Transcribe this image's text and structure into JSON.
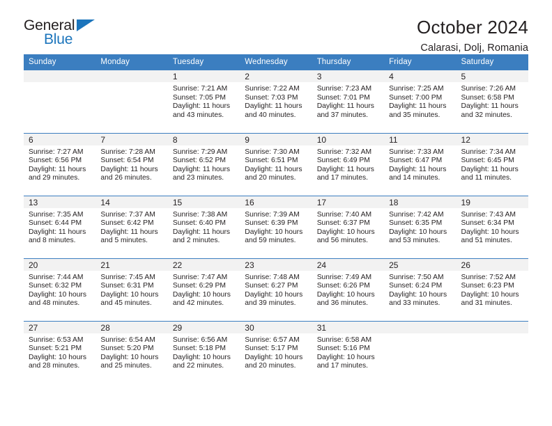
{
  "brand": {
    "name_top": "General",
    "name_bottom": "Blue",
    "accent_color": "#1c75bc"
  },
  "header": {
    "title": "October 2024",
    "subtitle": "Calarasi, Dolj, Romania",
    "header_bg_color": "#3b7ec0",
    "daynum_bg_color": "#f2f2f2"
  },
  "weekdays": [
    "Sunday",
    "Monday",
    "Tuesday",
    "Wednesday",
    "Thursday",
    "Friday",
    "Saturday"
  ],
  "labels": {
    "sunrise": "Sunrise:",
    "sunset": "Sunset:",
    "daylight": "Daylight:"
  },
  "weeks": [
    [
      {
        "day": "",
        "empty": true
      },
      {
        "day": "",
        "empty": true
      },
      {
        "day": "1",
        "sunrise": "Sunrise: 7:21 AM",
        "sunset": "Sunset: 7:05 PM",
        "daylight_1": "Daylight: 11 hours",
        "daylight_2": "and 43 minutes."
      },
      {
        "day": "2",
        "sunrise": "Sunrise: 7:22 AM",
        "sunset": "Sunset: 7:03 PM",
        "daylight_1": "Daylight: 11 hours",
        "daylight_2": "and 40 minutes."
      },
      {
        "day": "3",
        "sunrise": "Sunrise: 7:23 AM",
        "sunset": "Sunset: 7:01 PM",
        "daylight_1": "Daylight: 11 hours",
        "daylight_2": "and 37 minutes."
      },
      {
        "day": "4",
        "sunrise": "Sunrise: 7:25 AM",
        "sunset": "Sunset: 7:00 PM",
        "daylight_1": "Daylight: 11 hours",
        "daylight_2": "and 35 minutes."
      },
      {
        "day": "5",
        "sunrise": "Sunrise: 7:26 AM",
        "sunset": "Sunset: 6:58 PM",
        "daylight_1": "Daylight: 11 hours",
        "daylight_2": "and 32 minutes."
      }
    ],
    [
      {
        "day": "6",
        "sunrise": "Sunrise: 7:27 AM",
        "sunset": "Sunset: 6:56 PM",
        "daylight_1": "Daylight: 11 hours",
        "daylight_2": "and 29 minutes."
      },
      {
        "day": "7",
        "sunrise": "Sunrise: 7:28 AM",
        "sunset": "Sunset: 6:54 PM",
        "daylight_1": "Daylight: 11 hours",
        "daylight_2": "and 26 minutes."
      },
      {
        "day": "8",
        "sunrise": "Sunrise: 7:29 AM",
        "sunset": "Sunset: 6:52 PM",
        "daylight_1": "Daylight: 11 hours",
        "daylight_2": "and 23 minutes."
      },
      {
        "day": "9",
        "sunrise": "Sunrise: 7:30 AM",
        "sunset": "Sunset: 6:51 PM",
        "daylight_1": "Daylight: 11 hours",
        "daylight_2": "and 20 minutes."
      },
      {
        "day": "10",
        "sunrise": "Sunrise: 7:32 AM",
        "sunset": "Sunset: 6:49 PM",
        "daylight_1": "Daylight: 11 hours",
        "daylight_2": "and 17 minutes."
      },
      {
        "day": "11",
        "sunrise": "Sunrise: 7:33 AM",
        "sunset": "Sunset: 6:47 PM",
        "daylight_1": "Daylight: 11 hours",
        "daylight_2": "and 14 minutes."
      },
      {
        "day": "12",
        "sunrise": "Sunrise: 7:34 AM",
        "sunset": "Sunset: 6:45 PM",
        "daylight_1": "Daylight: 11 hours",
        "daylight_2": "and 11 minutes."
      }
    ],
    [
      {
        "day": "13",
        "sunrise": "Sunrise: 7:35 AM",
        "sunset": "Sunset: 6:44 PM",
        "daylight_1": "Daylight: 11 hours",
        "daylight_2": "and 8 minutes."
      },
      {
        "day": "14",
        "sunrise": "Sunrise: 7:37 AM",
        "sunset": "Sunset: 6:42 PM",
        "daylight_1": "Daylight: 11 hours",
        "daylight_2": "and 5 minutes."
      },
      {
        "day": "15",
        "sunrise": "Sunrise: 7:38 AM",
        "sunset": "Sunset: 6:40 PM",
        "daylight_1": "Daylight: 11 hours",
        "daylight_2": "and 2 minutes."
      },
      {
        "day": "16",
        "sunrise": "Sunrise: 7:39 AM",
        "sunset": "Sunset: 6:39 PM",
        "daylight_1": "Daylight: 10 hours",
        "daylight_2": "and 59 minutes."
      },
      {
        "day": "17",
        "sunrise": "Sunrise: 7:40 AM",
        "sunset": "Sunset: 6:37 PM",
        "daylight_1": "Daylight: 10 hours",
        "daylight_2": "and 56 minutes."
      },
      {
        "day": "18",
        "sunrise": "Sunrise: 7:42 AM",
        "sunset": "Sunset: 6:35 PM",
        "daylight_1": "Daylight: 10 hours",
        "daylight_2": "and 53 minutes."
      },
      {
        "day": "19",
        "sunrise": "Sunrise: 7:43 AM",
        "sunset": "Sunset: 6:34 PM",
        "daylight_1": "Daylight: 10 hours",
        "daylight_2": "and 51 minutes."
      }
    ],
    [
      {
        "day": "20",
        "sunrise": "Sunrise: 7:44 AM",
        "sunset": "Sunset: 6:32 PM",
        "daylight_1": "Daylight: 10 hours",
        "daylight_2": "and 48 minutes."
      },
      {
        "day": "21",
        "sunrise": "Sunrise: 7:45 AM",
        "sunset": "Sunset: 6:31 PM",
        "daylight_1": "Daylight: 10 hours",
        "daylight_2": "and 45 minutes."
      },
      {
        "day": "22",
        "sunrise": "Sunrise: 7:47 AM",
        "sunset": "Sunset: 6:29 PM",
        "daylight_1": "Daylight: 10 hours",
        "daylight_2": "and 42 minutes."
      },
      {
        "day": "23",
        "sunrise": "Sunrise: 7:48 AM",
        "sunset": "Sunset: 6:27 PM",
        "daylight_1": "Daylight: 10 hours",
        "daylight_2": "and 39 minutes."
      },
      {
        "day": "24",
        "sunrise": "Sunrise: 7:49 AM",
        "sunset": "Sunset: 6:26 PM",
        "daylight_1": "Daylight: 10 hours",
        "daylight_2": "and 36 minutes."
      },
      {
        "day": "25",
        "sunrise": "Sunrise: 7:50 AM",
        "sunset": "Sunset: 6:24 PM",
        "daylight_1": "Daylight: 10 hours",
        "daylight_2": "and 33 minutes."
      },
      {
        "day": "26",
        "sunrise": "Sunrise: 7:52 AM",
        "sunset": "Sunset: 6:23 PM",
        "daylight_1": "Daylight: 10 hours",
        "daylight_2": "and 31 minutes."
      }
    ],
    [
      {
        "day": "27",
        "sunrise": "Sunrise: 6:53 AM",
        "sunset": "Sunset: 5:21 PM",
        "daylight_1": "Daylight: 10 hours",
        "daylight_2": "and 28 minutes."
      },
      {
        "day": "28",
        "sunrise": "Sunrise: 6:54 AM",
        "sunset": "Sunset: 5:20 PM",
        "daylight_1": "Daylight: 10 hours",
        "daylight_2": "and 25 minutes."
      },
      {
        "day": "29",
        "sunrise": "Sunrise: 6:56 AM",
        "sunset": "Sunset: 5:18 PM",
        "daylight_1": "Daylight: 10 hours",
        "daylight_2": "and 22 minutes."
      },
      {
        "day": "30",
        "sunrise": "Sunrise: 6:57 AM",
        "sunset": "Sunset: 5:17 PM",
        "daylight_1": "Daylight: 10 hours",
        "daylight_2": "and 20 minutes."
      },
      {
        "day": "31",
        "sunrise": "Sunrise: 6:58 AM",
        "sunset": "Sunset: 5:16 PM",
        "daylight_1": "Daylight: 10 hours",
        "daylight_2": "and 17 minutes."
      },
      {
        "day": "",
        "empty": true
      },
      {
        "day": "",
        "empty": true
      }
    ]
  ]
}
